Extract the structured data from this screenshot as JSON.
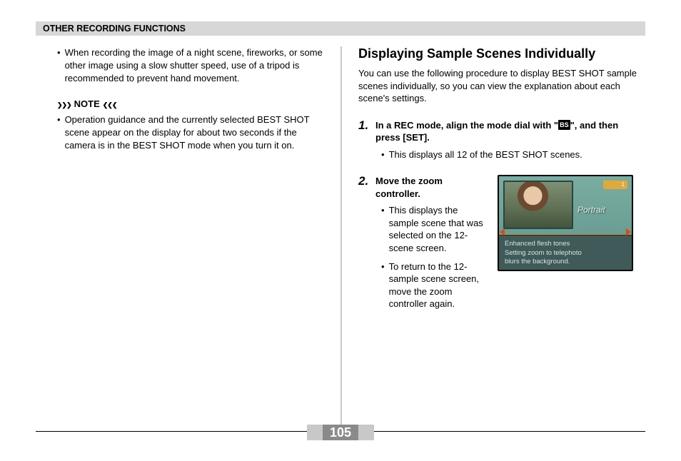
{
  "header": {
    "title": "OTHER RECORDING FUNCTIONS"
  },
  "left": {
    "tripod_tip": "When recording the image of a night scene, fireworks, or some other image using a slow shutter speed, use of a tripod is recommended to prevent hand movement.",
    "note_label": "NOTE",
    "note_body": "Operation guidance and the currently selected BEST SHOT scene appear on the display for about two seconds if the camera is in the BEST SHOT mode when you turn it on."
  },
  "right": {
    "heading": "Displaying Sample Scenes Individually",
    "intro": "You can use the following procedure to display BEST SHOT sample scenes individually, so you can view the explanation about each scene's settings.",
    "step1": {
      "num": "1.",
      "heading_pre": "In a REC mode, align the mode dial with \"",
      "bs_chip": "BS",
      "heading_post": "\", and then press [SET].",
      "bullet": "This displays all 12 of the BEST SHOT scenes."
    },
    "step2": {
      "num": "2.",
      "heading": "Move the zoom controller.",
      "bullet1": "This displays the sample scene that was selected on the 12-scene screen.",
      "bullet2": "To return to the 12-sample scene screen, move the zoom controller again."
    },
    "lcd": {
      "badge": "1",
      "mode": "Portrait",
      "desc_line1": "Enhanced flesh tones",
      "desc_line2": "Setting zoom to telephoto",
      "desc_line3": "blurs the background."
    }
  },
  "page_number": "105"
}
